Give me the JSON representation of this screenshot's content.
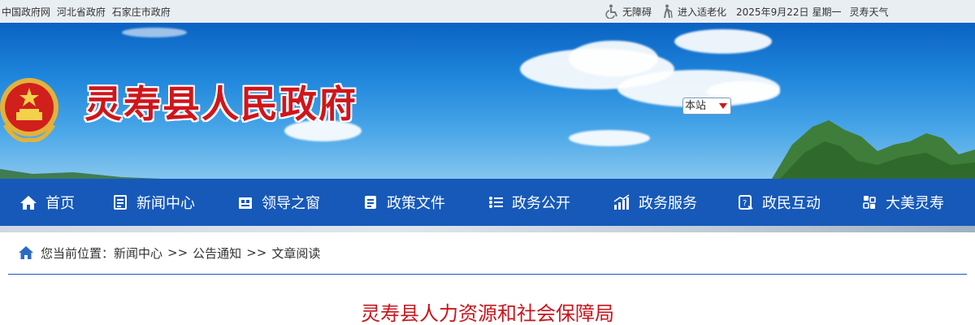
{
  "topbar": {
    "links": [
      "中国政府网",
      "河北省政府",
      "石家庄市政府"
    ],
    "accessibility_label": "无障碍",
    "elderly_label": "进入适老化",
    "date": "2025年9月22日",
    "weekday": "星期一",
    "weather_label": "灵寿天气"
  },
  "header": {
    "site_title": "灵寿县人民政府",
    "search_scope": "本站",
    "emblem_icon": "national-emblem"
  },
  "nav": {
    "items": [
      {
        "label": "首页",
        "icon": "home-icon"
      },
      {
        "label": "新闻中心",
        "icon": "news-icon"
      },
      {
        "label": "领导之窗",
        "icon": "leaders-icon"
      },
      {
        "label": "政策文件",
        "icon": "policy-document-icon"
      },
      {
        "label": "政务公开",
        "icon": "list-icon"
      },
      {
        "label": "政务服务",
        "icon": "chart-icon"
      },
      {
        "label": "政民互动",
        "icon": "interaction-icon"
      },
      {
        "label": "大美灵寿",
        "icon": "tiles-icon"
      }
    ]
  },
  "breadcrumb": {
    "prefix": "您当前位置：",
    "items": [
      "新闻中心",
      "公告通知",
      "文章阅读"
    ],
    "separator": ">>"
  },
  "article": {
    "title": "灵寿县人力资源和社会保障局"
  },
  "colors": {
    "nav_bg": "#1659b9",
    "title_red": "#d0151b",
    "topbar_bg": "#e9eef3"
  }
}
